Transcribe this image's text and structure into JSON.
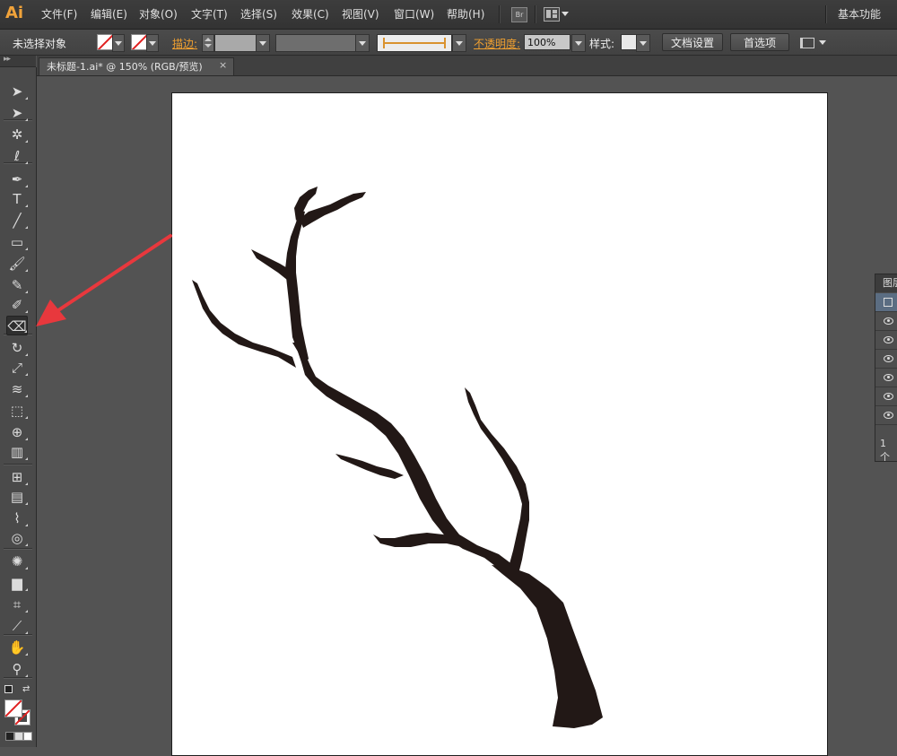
{
  "app": {
    "logo": "Ai"
  },
  "menubar": {
    "items": [
      {
        "id": "file",
        "label": "文件(F)"
      },
      {
        "id": "edit",
        "label": "编辑(E)"
      },
      {
        "id": "object",
        "label": "对象(O)"
      },
      {
        "id": "type",
        "label": "文字(T)"
      },
      {
        "id": "select",
        "label": "选择(S)"
      },
      {
        "id": "effect",
        "label": "效果(C)"
      },
      {
        "id": "view",
        "label": "视图(V)"
      },
      {
        "id": "window",
        "label": "窗口(W)"
      },
      {
        "id": "help",
        "label": "帮助(H)"
      }
    ],
    "bridge_label": "Br",
    "workspace": "基本功能"
  },
  "controlbar": {
    "selection_status": "未选择对象",
    "stroke_label": "描边:",
    "opacity_label": "不透明度:",
    "opacity_value": "100%",
    "style_label": "样式:",
    "doc_setup_button": "文档设置",
    "preferences_button": "首选项"
  },
  "document": {
    "tab_title": "未标题-1.ai* @ 150% (RGB/预览)",
    "close_glyph": "×"
  },
  "toolbar": {
    "header": "▸▸",
    "active_tool": "eraser-tool",
    "tools": [
      {
        "name": "selection-tool",
        "glyph": "➤"
      },
      {
        "name": "direct-selection-tool",
        "glyph": "➤"
      },
      {
        "name": "magic-wand-tool",
        "glyph": "✲"
      },
      {
        "name": "lasso-tool",
        "glyph": "ℓ"
      },
      {
        "name": "pen-tool",
        "glyph": "✒"
      },
      {
        "name": "type-tool",
        "glyph": "T"
      },
      {
        "name": "line-segment-tool",
        "glyph": "╱"
      },
      {
        "name": "rectangle-tool",
        "glyph": "▭"
      },
      {
        "name": "paintbrush-tool",
        "glyph": "🖌"
      },
      {
        "name": "pencil-tool",
        "glyph": "✎"
      },
      {
        "name": "blob-brush-tool",
        "glyph": "✐"
      },
      {
        "name": "eraser-tool",
        "glyph": "⌫"
      },
      {
        "name": "rotate-tool",
        "glyph": "↻"
      },
      {
        "name": "scale-tool",
        "glyph": "⤢"
      },
      {
        "name": "warp-tool",
        "glyph": "≋"
      },
      {
        "name": "free-transform-tool",
        "glyph": "⬚"
      },
      {
        "name": "shape-builder-tool",
        "glyph": "⊕"
      },
      {
        "name": "perspective-grid-tool",
        "glyph": "▥"
      },
      {
        "name": "mesh-tool",
        "glyph": "⊞"
      },
      {
        "name": "gradient-tool",
        "glyph": "▤"
      },
      {
        "name": "eyedropper-tool",
        "glyph": "⌇"
      },
      {
        "name": "blend-tool",
        "glyph": "◎"
      },
      {
        "name": "symbol-sprayer-tool",
        "glyph": "✺"
      },
      {
        "name": "column-graph-tool",
        "glyph": "▆"
      },
      {
        "name": "artboard-tool",
        "glyph": "⌗"
      },
      {
        "name": "slice-tool",
        "glyph": "⟋"
      },
      {
        "name": "hand-tool",
        "glyph": "✋"
      },
      {
        "name": "zoom-tool",
        "glyph": "⚲"
      }
    ]
  },
  "layers_panel": {
    "tab_label": "图层",
    "footer": "1 个"
  },
  "colors": {
    "menubar_bg": "#363636",
    "workspace_bg": "#535353",
    "accent_orange": "#f0a030",
    "artboard": "#ffffff",
    "artwork": "#221816",
    "annotation_arrow": "#e8383d"
  }
}
